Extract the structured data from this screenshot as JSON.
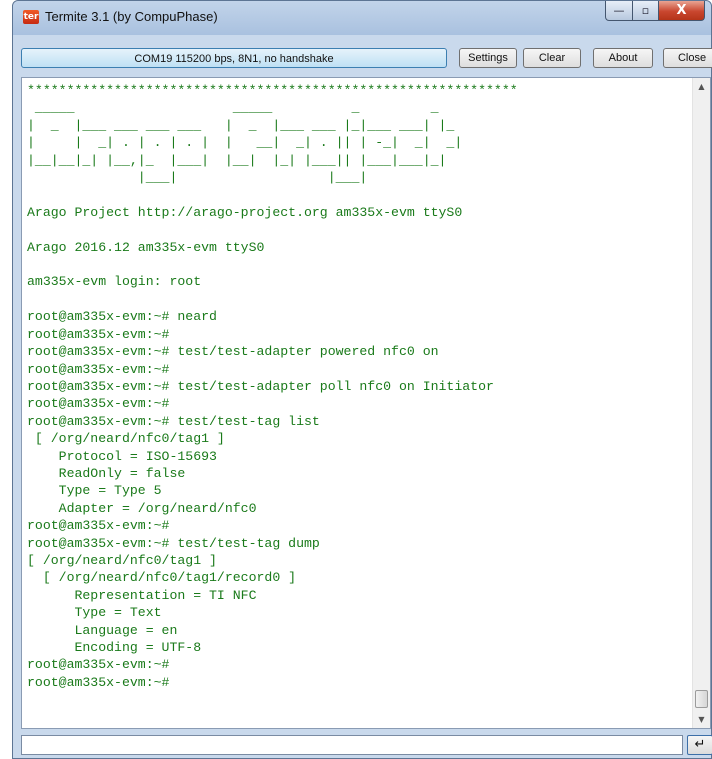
{
  "window": {
    "title": "Termite 3.1 (by CompuPhase)",
    "icon_text": "ter",
    "caption": {
      "minimize": "—",
      "maximize": "▫",
      "close": "X"
    }
  },
  "toolbar": {
    "connection_status": "COM19 115200 bps, 8N1, no handshake",
    "settings_label": "Settings",
    "clear_label": "Clear",
    "about_label": "About",
    "close_label": "Close"
  },
  "terminal": {
    "lines": [
      "**************************************************************",
      " _____                    _____          _         _",
      "|  _  |___ ___ ___ ___   |  _  |___ ___ |_|___ ___| |_",
      "|     |  _| . | . | . |  |   __|  _| . || | -_|  _|  _|",
      "|__|__|_| |__,|_  |___|  |__|  |_| |___|| |___|___|_|",
      "              |___|                   |___|",
      "",
      "Arago Project http://arago-project.org am335x-evm ttyS0",
      "",
      "Arago 2016.12 am335x-evm ttyS0",
      "",
      "am335x-evm login: root",
      "",
      "root@am335x-evm:~# neard",
      "root@am335x-evm:~#",
      "root@am335x-evm:~# test/test-adapter powered nfc0 on",
      "root@am335x-evm:~#",
      "root@am335x-evm:~# test/test-adapter poll nfc0 on Initiator",
      "root@am335x-evm:~#",
      "root@am335x-evm:~# test/test-tag list",
      " [ /org/neard/nfc0/tag1 ]",
      "    Protocol = ISO-15693",
      "    ReadOnly = false",
      "    Type = Type 5",
      "    Adapter = /org/neard/nfc0",
      "root@am335x-evm:~#",
      "root@am335x-evm:~# test/test-tag dump",
      "[ /org/neard/nfc0/tag1 ]",
      "  [ /org/neard/nfc0/tag1/record0 ]",
      "      Representation = TI NFC",
      "      Type = Text",
      "      Language = en",
      "      Encoding = UTF-8",
      "root@am335x-evm:~#",
      "root@am335x-evm:~#"
    ]
  },
  "scrollbar": {
    "up_arrow": "▲",
    "down_arrow": "▼"
  },
  "input": {
    "value": "",
    "send_label": "↵"
  },
  "colors": {
    "terminal_text": "#1a7a1a",
    "status_field_bg": "#bee0f4",
    "close_button": "#c9472f"
  }
}
